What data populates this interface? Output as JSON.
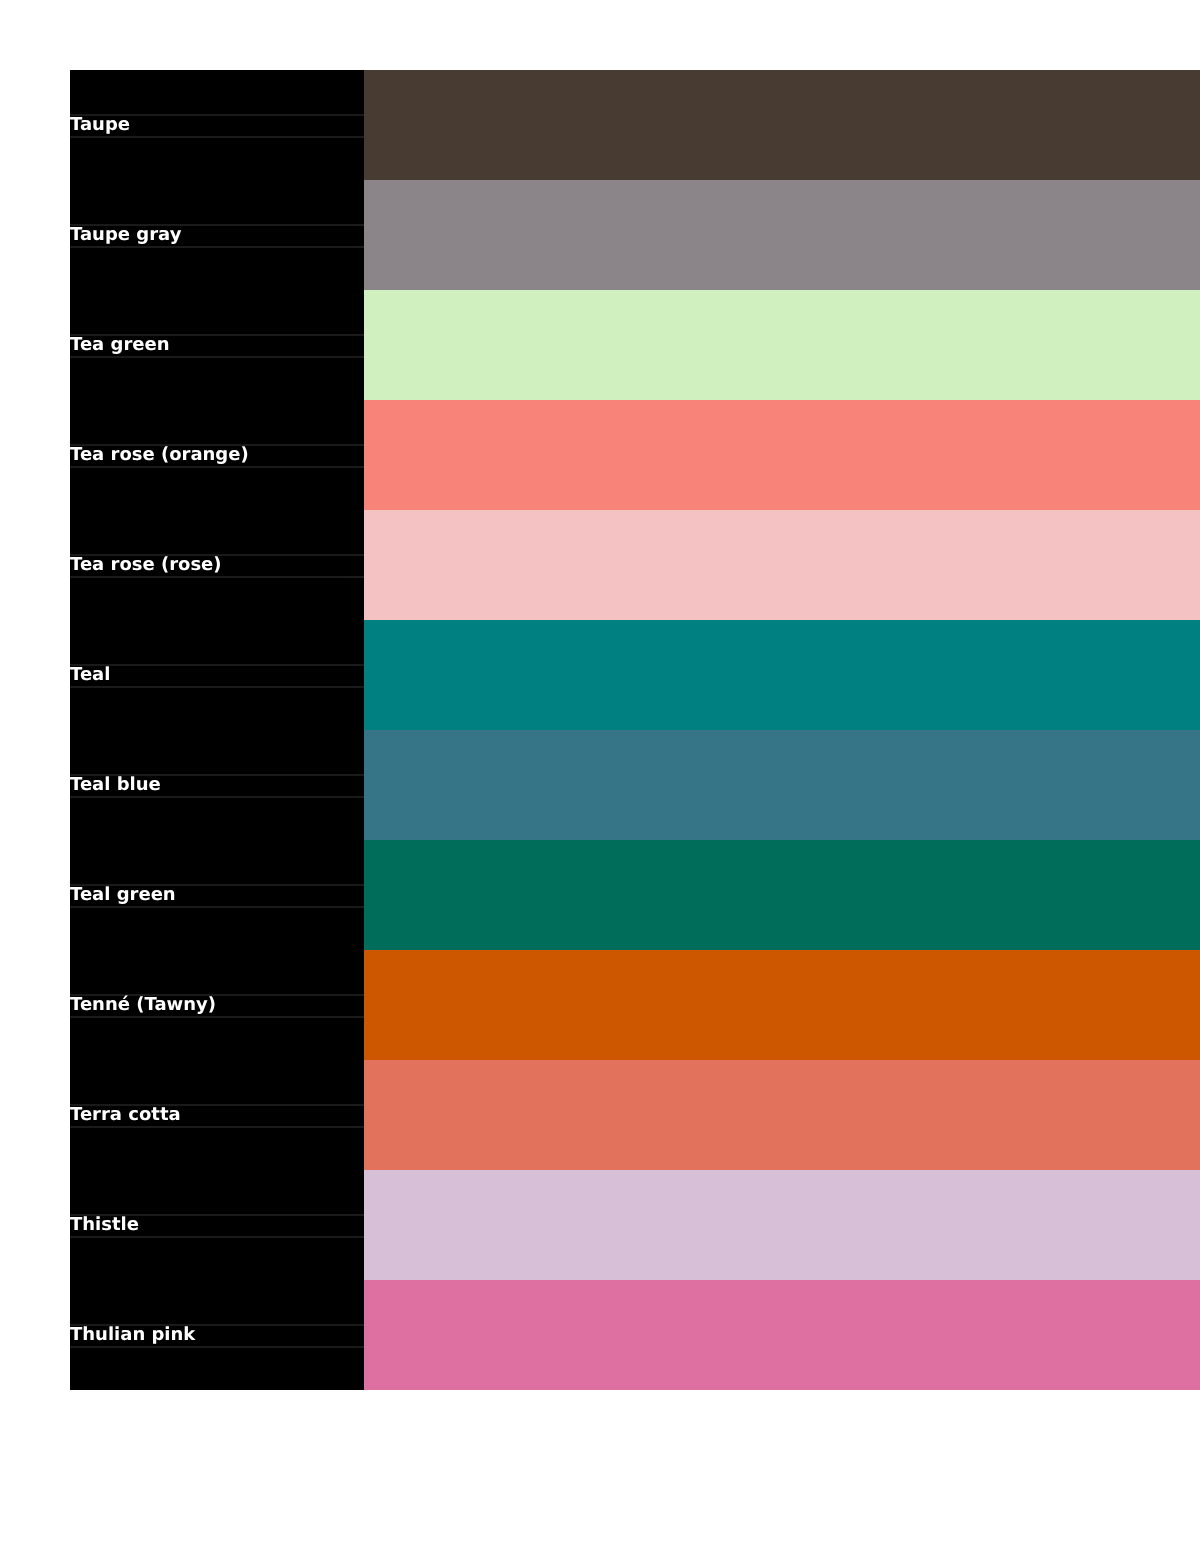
{
  "colors": [
    {
      "name": "Taupe",
      "color": "#483c32"
    },
    {
      "name": "Taupe gray",
      "color": "#8b8589"
    },
    {
      "name": "Tea green",
      "color": "#d0f0c0"
    },
    {
      "name": "Tea rose (orange)",
      "color": "#f88379"
    },
    {
      "name": "Tea rose (rose)",
      "color": "#f4c2c2"
    },
    {
      "name": "Teal",
      "color": "#008080"
    },
    {
      "name": "Teal blue",
      "color": "#367588"
    },
    {
      "name": "Teal green",
      "color": "#006d5b"
    },
    {
      "name": "Tenné (Tawny)",
      "color": "#cd5700"
    },
    {
      "name": "Terra cotta",
      "color": "#e2725b"
    },
    {
      "name": "Thistle",
      "color": "#d8bfd8"
    },
    {
      "name": "Thulian pink",
      "color": "#de6fa1"
    }
  ]
}
